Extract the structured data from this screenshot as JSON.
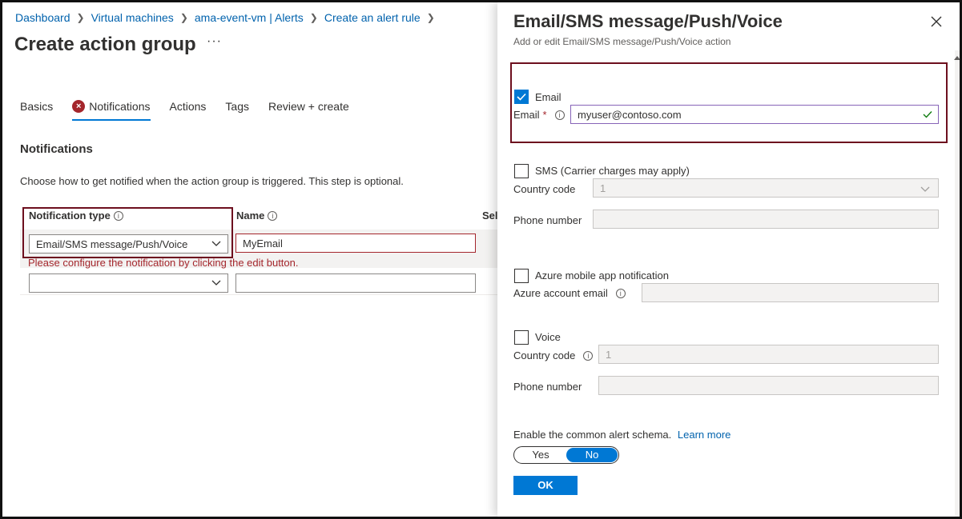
{
  "breadcrumb": [
    "Dashboard",
    "Virtual machines",
    "ama-event-vm | Alerts",
    "Create an alert rule"
  ],
  "page": {
    "title": "Create action group",
    "more": "···"
  },
  "tabs": [
    {
      "label": "Basics"
    },
    {
      "label": "Notifications"
    },
    {
      "label": "Actions"
    },
    {
      "label": "Tags"
    },
    {
      "label": "Review + create"
    }
  ],
  "notifications": {
    "title": "Notifications",
    "description": "Choose how to get notified when the action group is triggered. This step is optional.",
    "col_type": "Notification type",
    "col_name": "Name",
    "col_selected": "Sele",
    "row1_type": "Email/SMS message/Push/Voice",
    "row1_name": "MyEmail",
    "row1_error": "Please configure the notification by clicking the edit button."
  },
  "panel": {
    "title": "Email/SMS message/Push/Voice",
    "subtitle": "Add or edit Email/SMS message/Push/Voice action",
    "email_check": "Email",
    "email_label": "Email",
    "email_required": "*",
    "email_value": "myuser@contoso.com",
    "sms_check": "SMS (Carrier charges may apply)",
    "sms_country_label": "Country code",
    "sms_country_value": "1",
    "sms_phone_label": "Phone number",
    "push_check": "Azure mobile app notification",
    "push_email_label": "Azure account email",
    "voice_check": "Voice",
    "voice_country_label": "Country code",
    "voice_country_value": "1",
    "voice_phone_label": "Phone number",
    "schema_label": "Enable the common alert schema.",
    "learn_more": "Learn more",
    "toggle_yes": "Yes",
    "toggle_no": "No",
    "ok": "OK"
  },
  "icons": {
    "info": "i",
    "error": "×"
  },
  "colors": {
    "accent": "#0078d4",
    "error": "#a4262c",
    "highlight": "#6d0f1e"
  }
}
